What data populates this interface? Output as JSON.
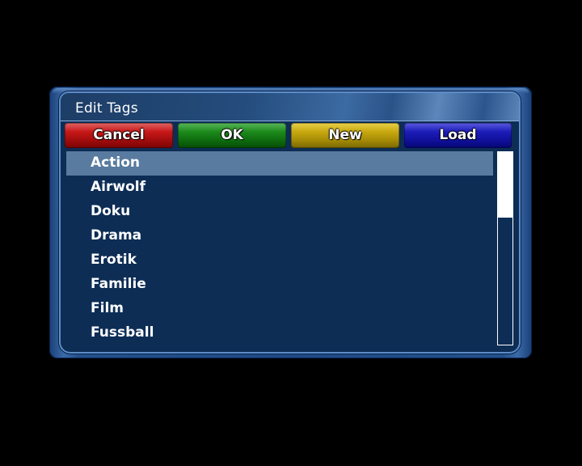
{
  "dialog": {
    "title": "Edit Tags"
  },
  "buttons": {
    "red": "Cancel",
    "green": "OK",
    "yellow": "New",
    "blue": "Load"
  },
  "colors": {
    "background": "#000000",
    "list_background": "#0d2d55",
    "selection": "#587b9f",
    "red_button": "#c81818",
    "green_button": "#1c8a1c",
    "yellow_button": "#c8a810",
    "blue_button": "#1c1cb8"
  },
  "tags": {
    "items": [
      "Action",
      "Airwolf",
      "Doku",
      "Drama",
      "Erotik",
      "Familie",
      "Film",
      "Fussball"
    ],
    "selected_index": 0
  },
  "scrollbar": {
    "thumb_fraction": 0.34
  }
}
